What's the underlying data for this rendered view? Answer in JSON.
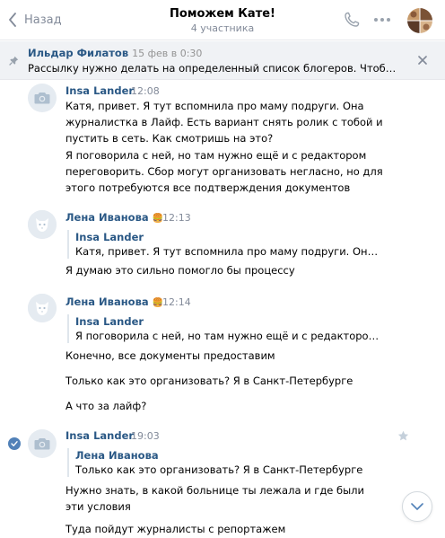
{
  "header": {
    "back_label": "Назад",
    "title": "Поможем Кате!",
    "subtitle": "4 участника"
  },
  "pinned": {
    "author": "Ильдар Филатов",
    "date": "15 фев в 0:30",
    "text": "Рассылку нужно делать на определенный список блогеров. Чтобы по..."
  },
  "messages": [
    {
      "author": "Insa Lander",
      "time": "12:08",
      "texts": [
        "Катя, привет. Я тут вспомнила про маму подруги. Она журналистка в Лайф. Есть вариант снять ролик с тобой и пустить в сеть. Как смотришь на это?",
        "Я поговорила с ней, но там нужно ещё и с редактором переговорить. Сбор могут организовать негласно, но для этого потребуются все подтверждения документов"
      ]
    },
    {
      "author": "Лена Иванова",
      "emoji": "🍔",
      "time": "12:13",
      "quote_author": "Insa Lander",
      "quote_text": "Катя, привет. Я тут вспомнила про маму подруги. Она ж...",
      "texts": [
        "Я думаю это сильно помогло бы процессу"
      ]
    },
    {
      "author": "Лена Иванова",
      "emoji": "🍔",
      "time": "12:14",
      "quote_author": "Insa Lander",
      "quote_text": "Я поговорила с ней, но там нужно ещё и с редактором п...",
      "texts": [
        "Конечно, все документы предоставим",
        "Только как это организовать? Я в Санкт-Петербурге",
        "А что за лайф?"
      ]
    },
    {
      "author": "Insa Lander",
      "time": "19:03",
      "quote_author": "Лена Иванова",
      "quote_text": "Только как это организовать? Я в Санкт-Петербурге",
      "texts": [
        "Нужно знать, в какой больнице ты лежала и где были эти условия",
        "Туда пойдут журналисты с репортажем"
      ]
    }
  ],
  "colors": {
    "link": "#2a5885",
    "muted": "#828a99",
    "accent": "#5181b8",
    "pinned_bg": "#f0f2f5"
  },
  "icons": {
    "back": "chevron-left-icon",
    "call": "phone-icon",
    "more": "more-horizontal-icon",
    "pin": "pin-icon",
    "close": "close-icon",
    "camera": "camera-placeholder-icon",
    "dog": "deactivated-dog-avatar-icon",
    "check": "checkmark-icon",
    "star": "star-icon",
    "scroll": "chevron-down-icon"
  }
}
